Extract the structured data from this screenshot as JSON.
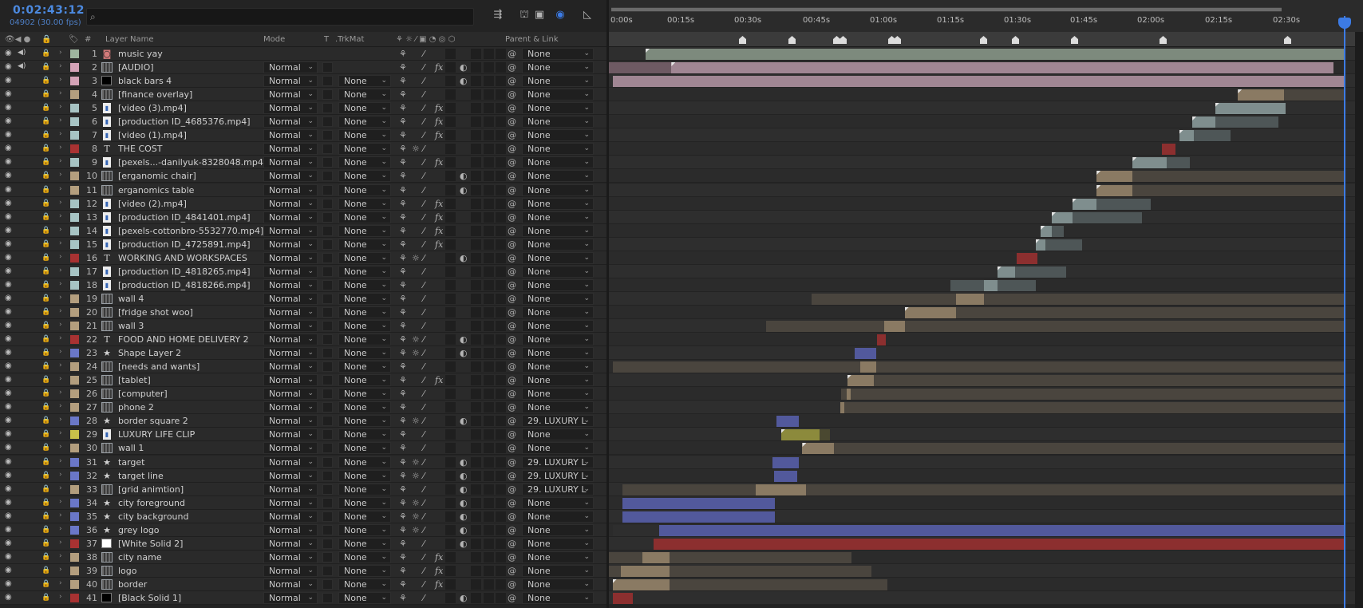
{
  "header": {
    "timecode": "0:02:43:12",
    "frames": "04902 (30.00 fps)",
    "search_placeholder": "",
    "col_layer_name": "Layer Name",
    "col_mode": "Mode",
    "col_t": "T",
    "col_trkmat": ".TrkMat",
    "col_parent": "Parent & Link"
  },
  "ruler": {
    "labels": [
      "0:00s",
      "00:15s",
      "00:30s",
      "00:45s",
      "01:00s",
      "01:15s",
      "01:30s",
      "01:45s",
      "02:00s",
      "02:15s",
      "02:30s"
    ]
  },
  "colors": {
    "accent": "#3c7be5",
    "label_green": "#9eb59f",
    "label_pink": "#d4a3b8",
    "label_tan": "#b39e7e",
    "label_cyan": "#a7c4c4",
    "label_red": "#a83232",
    "label_blue": "#6a77c8",
    "label_yellow": "#c8c04a"
  },
  "layers": [
    {
      "num": "1",
      "name": "music yay",
      "type": "audio",
      "label": "#9eb59f",
      "mode": "",
      "trk": "",
      "parent": "None",
      "bars": [
        [
          5.0,
          100,
          "#7d8a7d",
          1
        ]
      ]
    },
    {
      "num": "2",
      "name": "[AUDIO]",
      "type": "footage",
      "label": "#d4a3b8",
      "mode": "Normal",
      "trk": "",
      "parent": "None",
      "fx": true,
      "bars": [
        [
          0,
          8.5,
          "#6e5a63",
          0
        ],
        [
          8.5,
          98.5,
          "#a08693",
          1
        ]
      ]
    },
    {
      "num": "3",
      "name": "black bars 4",
      "type": "solid",
      "solid": "#000000",
      "label": "#d4a3b8",
      "mode": "Normal",
      "trk": "None",
      "parent": "None",
      "bars": [
        [
          0.5,
          100,
          "#a08693",
          0
        ]
      ]
    },
    {
      "num": "4",
      "name": "[finance overlay]",
      "type": "footage",
      "label": "#b39e7e",
      "mode": "Normal",
      "trk": "None",
      "parent": "None",
      "bars": [
        [
          85.5,
          91.8,
          "#8a7a63",
          1
        ],
        [
          91.8,
          100,
          "#4a453e",
          0
        ]
      ]
    },
    {
      "num": "5",
      "name": "[video (3).mp4]",
      "type": "video",
      "label": "#a7c4c4",
      "mode": "Normal",
      "trk": "None",
      "parent": "None",
      "fx": true,
      "bars": [
        [
          82.4,
          92.0,
          "#7f8e8e",
          1
        ]
      ]
    },
    {
      "num": "6",
      "name": "[production ID_4685376.mp4]",
      "type": "video",
      "label": "#a7c4c4",
      "mode": "Normal",
      "trk": "None",
      "parent": "None",
      "fx": true,
      "bars": [
        [
          79.3,
          82.4,
          "#7f8e8e",
          1
        ],
        [
          82.4,
          91.0,
          "#4e5657",
          0
        ]
      ]
    },
    {
      "num": "7",
      "name": "[video (1).mp4]",
      "type": "video",
      "label": "#a7c4c4",
      "mode": "Normal",
      "trk": "None",
      "parent": "None",
      "fx": true,
      "bars": [
        [
          77.5,
          79.5,
          "#7f8e8e",
          1
        ],
        [
          79.5,
          84.5,
          "#4e5657",
          0
        ]
      ]
    },
    {
      "num": "8",
      "name": "THE COST",
      "type": "text",
      "label": "#a83232",
      "mode": "Normal",
      "trk": "None",
      "parent": "None",
      "bars": [
        [
          75.2,
          77.0,
          "#8c2f2f",
          0
        ]
      ]
    },
    {
      "num": "9",
      "name": "[pexels...-danilyuk-8328048.mp4]",
      "type": "video",
      "label": "#a7c4c4",
      "mode": "Normal",
      "trk": "None",
      "parent": "None",
      "fx": true,
      "bars": [
        [
          71.2,
          75.8,
          "#7f8e8e",
          1
        ],
        [
          75.8,
          79.0,
          "#4e5657",
          0
        ]
      ]
    },
    {
      "num": "10",
      "name": "[erganomic chair]",
      "type": "footage",
      "label": "#b39e7e",
      "mode": "Normal",
      "trk": "None",
      "parent": "None",
      "bars": [
        [
          66.3,
          71.2,
          "#8a7a63",
          1
        ],
        [
          71.2,
          100,
          "#4a453e",
          0
        ]
      ]
    },
    {
      "num": "11",
      "name": "erganomics table",
      "type": "footage",
      "label": "#b39e7e",
      "mode": "Normal",
      "trk": "None",
      "parent": "None",
      "bars": [
        [
          66.3,
          71.2,
          "#8a7a63",
          1
        ],
        [
          71.2,
          100,
          "#4a453e",
          0
        ]
      ]
    },
    {
      "num": "12",
      "name": "[video (2).mp4]",
      "type": "video",
      "label": "#a7c4c4",
      "mode": "Normal",
      "trk": "None",
      "parent": "None",
      "fx": true,
      "bars": [
        [
          63.0,
          66.3,
          "#7f8e8e",
          1
        ],
        [
          66.3,
          73.6,
          "#4e5657",
          0
        ]
      ]
    },
    {
      "num": "13",
      "name": "[production ID_4841401.mp4]",
      "type": "video",
      "label": "#a7c4c4",
      "mode": "Normal",
      "trk": "None",
      "parent": "None",
      "fx": true,
      "bars": [
        [
          60.2,
          63.0,
          "#7f8e8e",
          1
        ],
        [
          63.0,
          72.5,
          "#4e5657",
          0
        ]
      ]
    },
    {
      "num": "14",
      "name": "[pexels-cottonbro-5532770.mp4]",
      "type": "video",
      "label": "#a7c4c4",
      "mode": "Normal",
      "trk": "None",
      "parent": "None",
      "fx": true,
      "bars": [
        [
          58.7,
          60.2,
          "#7f8e8e",
          1
        ],
        [
          60.2,
          61.8,
          "#4e5657",
          0
        ]
      ]
    },
    {
      "num": "15",
      "name": "[production ID_4725891.mp4]",
      "type": "video",
      "label": "#a7c4c4",
      "mode": "Normal",
      "trk": "None",
      "parent": "None",
      "fx": true,
      "bars": [
        [
          58.0,
          59.3,
          "#7f8e8e",
          1
        ],
        [
          59.3,
          64.3,
          "#4e5657",
          0
        ]
      ]
    },
    {
      "num": "16",
      "name": "WORKING AND WORKSPACES",
      "type": "text",
      "label": "#a83232",
      "mode": "Normal",
      "trk": "None",
      "parent": "None",
      "bars": [
        [
          55.4,
          58.2,
          "#8c2f2f",
          0
        ]
      ]
    },
    {
      "num": "17",
      "name": "[production ID_4818265.mp4]",
      "type": "video",
      "label": "#a7c4c4",
      "mode": "Normal",
      "trk": "None",
      "parent": "None",
      "bars": [
        [
          52.8,
          55.2,
          "#7f8e8e",
          1
        ],
        [
          55.2,
          62.2,
          "#4e5657",
          0
        ]
      ]
    },
    {
      "num": "18",
      "name": "[production ID_4818266.mp4]",
      "type": "video",
      "label": "#a7c4c4",
      "mode": "Normal",
      "trk": "None",
      "parent": "None",
      "bars": [
        [
          46.4,
          51.0,
          "#4e5657",
          0
        ],
        [
          51.0,
          52.8,
          "#7f8e8e",
          0
        ],
        [
          52.8,
          58.0,
          "#4e5657",
          0
        ]
      ]
    },
    {
      "num": "19",
      "name": "wall 4",
      "type": "footage",
      "label": "#b39e7e",
      "mode": "Normal",
      "trk": "None",
      "parent": "None",
      "bars": [
        [
          27.6,
          47.2,
          "#4a453e",
          0
        ],
        [
          47.2,
          51.0,
          "#8a7a63",
          0
        ],
        [
          51.0,
          100,
          "#4a453e",
          0
        ]
      ]
    },
    {
      "num": "20",
      "name": "[fridge shot woo]",
      "type": "footage",
      "label": "#b39e7e",
      "mode": "Normal",
      "trk": "None",
      "parent": "None",
      "bars": [
        [
          40.2,
          47.2,
          "#8a7a63",
          1
        ],
        [
          47.2,
          100,
          "#4a453e",
          0
        ]
      ]
    },
    {
      "num": "21",
      "name": "wall 3",
      "type": "footage",
      "label": "#b39e7e",
      "mode": "Normal",
      "trk": "None",
      "parent": "None",
      "bars": [
        [
          21.4,
          37.4,
          "#4a453e",
          0
        ],
        [
          37.4,
          40.2,
          "#8a7a63",
          0
        ],
        [
          40.2,
          100,
          "#4a453e",
          0
        ]
      ]
    },
    {
      "num": "22",
      "name": "FOOD AND HOME DELIVERY 2",
      "type": "text",
      "label": "#a83232",
      "mode": "Normal",
      "trk": "None",
      "parent": "None",
      "bars": [
        [
          36.4,
          37.6,
          "#8c2f2f",
          0
        ]
      ]
    },
    {
      "num": "23",
      "name": "Shape Layer 2",
      "type": "shape",
      "label": "#6a77c8",
      "mode": "Normal",
      "trk": "None",
      "parent": "None",
      "bars": [
        [
          33.4,
          36.3,
          "#52599c",
          0
        ]
      ]
    },
    {
      "num": "24",
      "name": "[needs and wants]",
      "type": "footage",
      "label": "#b39e7e",
      "mode": "Normal",
      "trk": "None",
      "parent": "None",
      "bars": [
        [
          0.5,
          34.2,
          "#4a453e",
          0
        ],
        [
          34.2,
          36.3,
          "#8a7a63",
          0
        ],
        [
          36.3,
          100,
          "#4a453e",
          0
        ]
      ]
    },
    {
      "num": "25",
      "name": "[tablet]",
      "type": "footage",
      "label": "#b39e7e",
      "mode": "Normal",
      "trk": "None",
      "parent": "None",
      "fx": true,
      "bars": [
        [
          32.4,
          36.0,
          "#8a7a63",
          1
        ],
        [
          36.0,
          100,
          "#4a453e",
          0
        ]
      ]
    },
    {
      "num": "26",
      "name": "[computer]",
      "type": "footage",
      "label": "#b39e7e",
      "mode": "Normal",
      "trk": "None",
      "parent": "None",
      "bars": [
        [
          31.6,
          32.3,
          "#4a453e",
          0
        ],
        [
          32.3,
          32.9,
          "#8a7a63",
          0
        ],
        [
          32.9,
          100,
          "#4a453e",
          0
        ]
      ]
    },
    {
      "num": "27",
      "name": "phone 2",
      "type": "footage",
      "label": "#b39e7e",
      "mode": "Normal",
      "trk": "None",
      "parent": "None",
      "bars": [
        [
          31.4,
          32.0,
          "#8a7a63",
          0
        ],
        [
          32.0,
          100,
          "#4a453e",
          0
        ]
      ]
    },
    {
      "num": "28",
      "name": "border square 2",
      "type": "shape",
      "label": "#6a77c8",
      "mode": "Normal",
      "trk": "None",
      "parent": "29. LUXURY L",
      "bars": [
        [
          22.8,
          25.8,
          "#52599c",
          0
        ]
      ]
    },
    {
      "num": "29",
      "name": "LUXURY LIFE CLIP",
      "type": "video",
      "label": "#c8c04a",
      "mode": "Normal",
      "trk": "None",
      "parent": "None",
      "bars": [
        [
          23.4,
          28.6,
          "#8c8a3c",
          1
        ],
        [
          28.6,
          30.0,
          "#4a4830",
          0
        ]
      ]
    },
    {
      "num": "30",
      "name": "wall 1",
      "type": "footage",
      "label": "#b39e7e",
      "mode": "Normal",
      "trk": "None",
      "parent": "None",
      "bars": [
        [
          26.3,
          30.6,
          "#8a7a63",
          1
        ],
        [
          30.6,
          100,
          "#4a453e",
          0
        ]
      ]
    },
    {
      "num": "31",
      "name": "target",
      "type": "shape",
      "label": "#6a77c8",
      "mode": "Normal",
      "trk": "None",
      "parent": "29. LUXURY L",
      "bars": [
        [
          22.2,
          25.8,
          "#52599c",
          0
        ]
      ]
    },
    {
      "num": "32",
      "name": "target line",
      "type": "shape",
      "label": "#6a77c8",
      "mode": "Normal",
      "trk": "None",
      "parent": "29. LUXURY L",
      "bars": [
        [
          22.4,
          25.6,
          "#52599c",
          0
        ]
      ]
    },
    {
      "num": "33",
      "name": "[grid animtion]",
      "type": "footage",
      "label": "#b39e7e",
      "mode": "Normal",
      "trk": "None",
      "parent": "29. LUXURY L",
      "bars": [
        [
          1.8,
          20.0,
          "#4a453e",
          0
        ],
        [
          20.0,
          26.8,
          "#8a7a63",
          0
        ],
        [
          26.8,
          100,
          "#4a453e",
          0
        ]
      ]
    },
    {
      "num": "34",
      "name": "city foreground",
      "type": "shape",
      "label": "#6a77c8",
      "mode": "Normal",
      "trk": "None",
      "parent": "None",
      "bars": [
        [
          1.8,
          22.6,
          "#52599c",
          0
        ]
      ]
    },
    {
      "num": "35",
      "name": "city background",
      "type": "shape",
      "label": "#6a77c8",
      "mode": "Normal",
      "trk": "None",
      "parent": "None",
      "bars": [
        [
          1.8,
          22.6,
          "#52599c",
          0
        ]
      ]
    },
    {
      "num": "36",
      "name": "grey logo",
      "type": "shape",
      "label": "#6a77c8",
      "mode": "Normal",
      "trk": "None",
      "parent": "None",
      "bars": [
        [
          0.5,
          6.8,
          "#2e2e2e",
          0
        ],
        [
          6.8,
          100,
          "#52599c",
          0
        ]
      ]
    },
    {
      "num": "37",
      "name": "[White Solid 2]",
      "type": "solid",
      "solid": "#ffffff",
      "label": "#a83232",
      "mode": "Normal",
      "trk": "None",
      "parent": "None",
      "bars": [
        [
          0.5,
          6.1,
          "#2e2e2e",
          0
        ],
        [
          6.1,
          100,
          "#8c2f2f",
          0
        ]
      ]
    },
    {
      "num": "38",
      "name": "city name",
      "type": "footage",
      "label": "#b39e7e",
      "mode": "Normal",
      "trk": "None",
      "parent": "None",
      "fx": true,
      "bars": [
        [
          0,
          4.6,
          "#4a453e",
          0
        ],
        [
          4.6,
          8.2,
          "#8a7a63",
          0
        ],
        [
          8.2,
          33.0,
          "#4a453e",
          0
        ]
      ]
    },
    {
      "num": "39",
      "name": "logo",
      "type": "footage",
      "label": "#b39e7e",
      "mode": "Normal",
      "trk": "None",
      "parent": "None",
      "fx": true,
      "bars": [
        [
          0,
          1.6,
          "#4a453e",
          0
        ],
        [
          1.6,
          8.2,
          "#8a7a63",
          0
        ],
        [
          8.2,
          35.7,
          "#4a453e",
          0
        ]
      ]
    },
    {
      "num": "40",
      "name": "border",
      "type": "footage",
      "label": "#b39e7e",
      "mode": "Normal",
      "trk": "None",
      "parent": "None",
      "fx": true,
      "bars": [
        [
          0.5,
          8.2,
          "#8a7a63",
          1
        ],
        [
          8.2,
          37.8,
          "#4a453e",
          0
        ]
      ]
    },
    {
      "num": "41",
      "name": "[Black Solid 1]",
      "type": "solid",
      "solid": "#000000",
      "label": "#a83232",
      "mode": "Normal",
      "trk": "None",
      "parent": "None",
      "bars": [
        [
          0.5,
          3.3,
          "#8c2f2f",
          0
        ]
      ]
    }
  ]
}
